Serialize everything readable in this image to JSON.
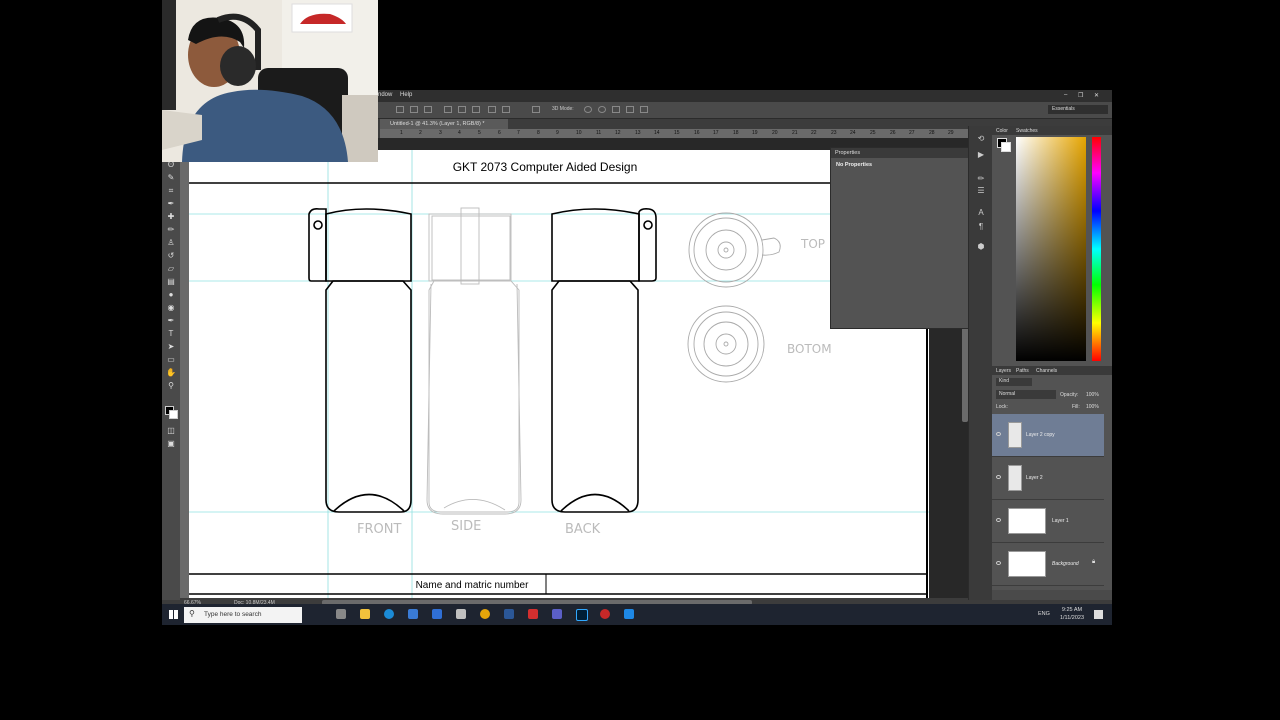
{
  "menubar": {
    "items": [
      "ndow",
      "Help"
    ]
  },
  "options_bar": {
    "mode_3d": "3D Mode:",
    "workspace": "Essentials"
  },
  "document": {
    "tab_title": "Untitled-1 @ 41.3% (Layer 1, RGB/8) *",
    "zoom": "66.67%",
    "doc_size": "Doc: 10.8M/23.4M",
    "ruler_ticks": [
      "1",
      "2",
      "3",
      "4",
      "5",
      "6",
      "7",
      "8",
      "9",
      "10",
      "11",
      "12",
      "13",
      "14",
      "15",
      "16",
      "17",
      "18",
      "19",
      "20",
      "21",
      "22",
      "23",
      "24",
      "25",
      "26",
      "27",
      "28",
      "29"
    ]
  },
  "sheet": {
    "title": "GKT 2073 Computer Aided Design",
    "footer_label": "Name and matric number",
    "view_labels": {
      "front": "FRONT",
      "side": "SIDE",
      "back": "BACK",
      "top": "TOP",
      "bottom": "BOTOM"
    }
  },
  "properties_panel": {
    "tab": "Properties",
    "message": "No Properties"
  },
  "color_panel": {
    "tabs": [
      "Color",
      "Swatches"
    ],
    "hue_color": "#e6a500"
  },
  "layers_panel": {
    "tabs": [
      "Layers",
      "Paths",
      "Channels"
    ],
    "filter": "Kind",
    "blend_mode": "Normal",
    "opacity_label": "Opacity:",
    "opacity": "100%",
    "lock_label": "Lock:",
    "fill_label": "Fill:",
    "fill": "100%",
    "layers": [
      {
        "name": "Layer 2 copy",
        "selected": true
      },
      {
        "name": "Layer 2",
        "selected": false
      },
      {
        "name": "Layer 1",
        "selected": false
      },
      {
        "name": "Background",
        "selected": false
      }
    ]
  },
  "taskbar": {
    "search_placeholder": "Type here to search",
    "language": "ENG",
    "time": "9:25 AM",
    "date": "1/11/2023"
  }
}
